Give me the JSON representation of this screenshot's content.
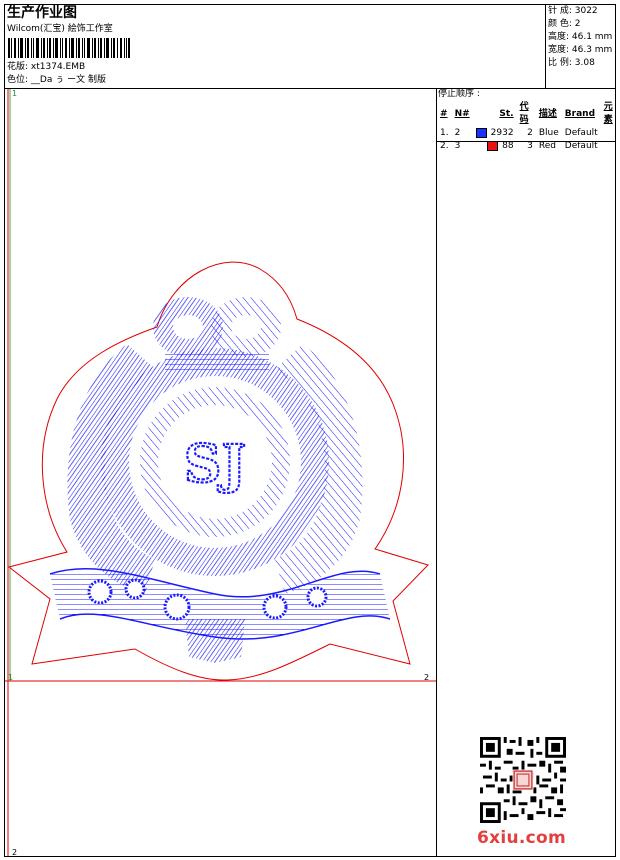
{
  "header": {
    "title": "生产作业图",
    "studio": "Wilcom(汇宝) 絵饰工作室",
    "design_file_label": "花版:",
    "design_file": "xt1374.EMB",
    "color_label": "色位:",
    "color_value": "__Da ぅ ー文 制版"
  },
  "stats": {
    "stitches": "针 成: 3022",
    "colors": "颜 色: 2",
    "height": "高度: 46.1 mm",
    "width": "宽度: 46.3 mm",
    "scale": "比 例: 3.08"
  },
  "sequence": {
    "title": "停止顺序 :",
    "headers": [
      "#",
      "N#",
      "St.",
      "代码",
      "描述",
      "Brand",
      "元素"
    ],
    "rows": [
      {
        "idx": "1.",
        "n": "2",
        "color": "#1733ff",
        "st": "2932",
        "code": "2",
        "desc": "Blue",
        "brand": "Default"
      },
      {
        "idx": "2.",
        "n": "3",
        "color": "#ee1111",
        "st": "88",
        "code": "3",
        "desc": "Red",
        "brand": "Default"
      }
    ]
  },
  "markers": {
    "top_left": "1",
    "mid_left": "1",
    "mid_right": "2",
    "bottom_left": "2"
  },
  "embroidery": {
    "monogram": "SJ",
    "stitch_color": "#1a1aff",
    "outline_color": "#e00000"
  },
  "watermark": "6xiu.com"
}
